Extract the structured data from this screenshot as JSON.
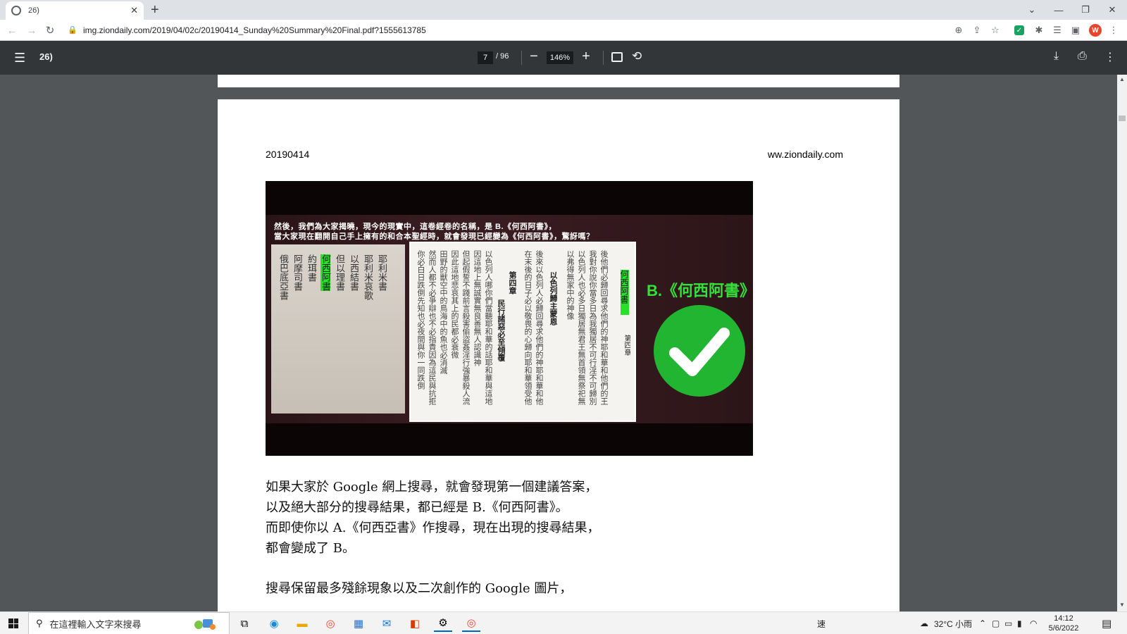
{
  "browser": {
    "tab_title": "26)",
    "url": "img.ziondaily.com/2019/04/02c/20190414_Sunday%20Summary%20Final.pdf?1555613785"
  },
  "pdf": {
    "title": "26)",
    "current_page": "7",
    "total_pages": "/ 96",
    "zoom": "146%"
  },
  "page": {
    "header_date": "20190414",
    "header_site": "ww.ziondaily.com",
    "figure": {
      "caption_line1": "然後，我們為大家揭曉，現今的現實中，這卷經卷的名稱，是 B.《何西阿書》，",
      "caption_line2": "當大家現在翻開自己手上擁有的和合本聖經時，就會發現已經變為《何西阿書》，驚訝嗎？",
      "answer_label": "B.《何西阿書》",
      "scan_highlight": "何西阿書",
      "scan_chapter": "第四章",
      "scan_heading": "民行諸惡必至傾覆"
    },
    "paragraphs": [
      "如果大家於 Google 網上搜尋，就會發現第一個建議答案，",
      "以及絕大部分的搜尋結果，都已經是 B.《何西阿書》。",
      "而即使你以 A.《何西亞書》作搜尋，現在出現的搜尋結果，",
      "都會變成了 B。",
      "搜尋保留最多殘餘現象以及二次創作的 Google 圖片，"
    ]
  },
  "taskbar": {
    "search_placeholder": "在這裡輸入文字來搜尋",
    "weather": "32°C 小雨",
    "time": "14:12",
    "date": "5/6/2022",
    "ime": "速"
  },
  "colors": {
    "highlight_green": "#27e02a",
    "answer_green": "#22b532",
    "pdf_toolbar": "#323639",
    "viewer_bg": "#525659"
  }
}
